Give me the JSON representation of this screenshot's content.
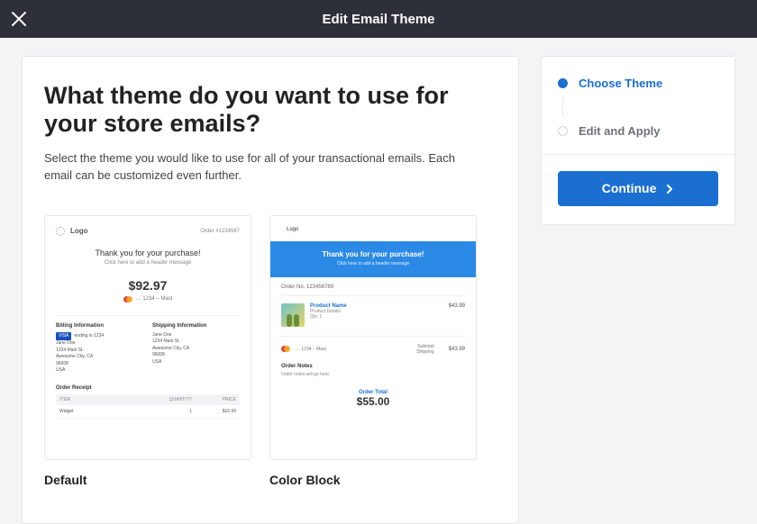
{
  "header": {
    "title": "Edit Email Theme"
  },
  "main": {
    "heading": "What theme do you want to use for your store emails?",
    "subtext": "Select the theme you would like to use for all of your transactional emails. Each email can be customized even further."
  },
  "themes": [
    {
      "name": "Default",
      "preview": {
        "logo_label": "Logo",
        "top_order": "Order #1234567",
        "thank_you": "Thank you for your purchase!",
        "header_msg": "Click here to add a header message",
        "price": "$92.97",
        "card_last4": "… 1234 – Mast",
        "billing_h": "Billing Information",
        "shipping_h": "Shipping Information",
        "visa_badge": "VISA",
        "visa_text": "ending in 1234",
        "address": [
          "Jane Doe",
          "1234 Main St.",
          "Awesome City, CA",
          "96008",
          "USA"
        ],
        "ship_address": [
          "Jane Doe",
          "1234 Main St.",
          "Awesome City, CA",
          "96008",
          "USA"
        ],
        "receipt_h": "Order Receipt",
        "cols": {
          "item": "ITEM",
          "qty": "QUANTITY",
          "price": "PRICE"
        },
        "row": {
          "item": "Widget",
          "qty": "1",
          "price": "$10.99"
        }
      }
    },
    {
      "name": "Color Block",
      "preview": {
        "logo_label": "Logo",
        "banner_title": "Thank you for your purchase!",
        "banner_sub": "Click here to add a header message",
        "order_no": "Order No. 123456789",
        "product_name": "Product Name",
        "product_details": "Product Details",
        "product_qty": "Qty: 1",
        "product_price": "$43.99",
        "card_last4": "… 1234 – Mast",
        "subtotal_label": "Subtotal",
        "shipping_label": "Shipping",
        "subtotal_value": "$43.99",
        "notes_h": "Order Notes",
        "notes_text": "Order notes will go here",
        "order_total_label": "Order Total",
        "order_total_value": "$55.00"
      }
    }
  ],
  "sidebar": {
    "steps": [
      {
        "label": "Choose Theme",
        "active": true
      },
      {
        "label": "Edit and Apply",
        "active": false
      }
    ],
    "continue_label": "Continue"
  }
}
